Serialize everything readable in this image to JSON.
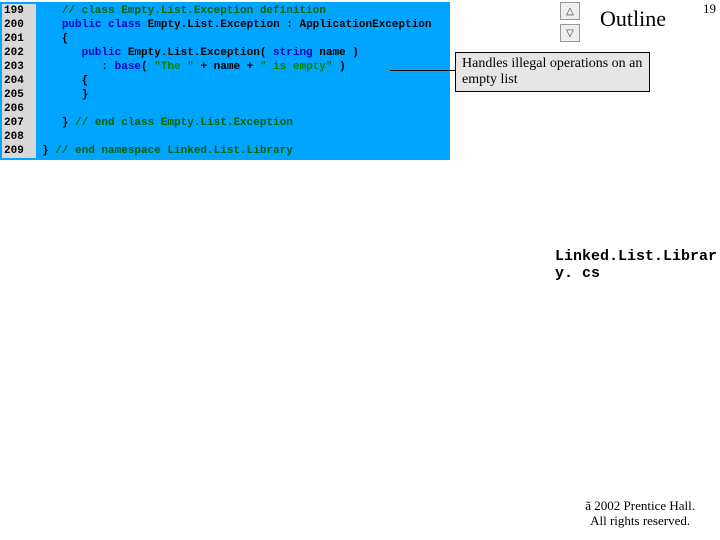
{
  "page_number": "19",
  "outline_label": "Outline",
  "callout_text": "Handles illegal operations on an empty list",
  "filename": "Linked.List.Librar\ny. cs",
  "copyright_l1": "ã 2002 Prentice Hall.",
  "copyright_l2": "All rights reserved.",
  "nav_up": "△",
  "nav_down": "▽",
  "code": [
    {
      "n": "199",
      "segs": [
        {
          "c": "kw-comment",
          "t": "   // class Empty.List.Exception definition"
        }
      ]
    },
    {
      "n": "200",
      "segs": [
        {
          "c": "kw-black",
          "t": "   "
        },
        {
          "c": "kw-blue",
          "t": "public"
        },
        {
          "c": "kw-black",
          "t": " "
        },
        {
          "c": "kw-blue",
          "t": "class"
        },
        {
          "c": "kw-black",
          "t": " Empty.List.Exception : Application"
        },
        {
          "c": "kw-black",
          "t": "Exception"
        }
      ]
    },
    {
      "n": "201",
      "segs": [
        {
          "c": "kw-black",
          "t": "   {"
        }
      ]
    },
    {
      "n": "202",
      "segs": [
        {
          "c": "kw-black",
          "t": "      "
        },
        {
          "c": "kw-blue",
          "t": "public"
        },
        {
          "c": "kw-black",
          "t": " Empty.List.Exception( "
        },
        {
          "c": "kw-blue",
          "t": "string"
        },
        {
          "c": "kw-black",
          "t": " name )"
        }
      ]
    },
    {
      "n": "203",
      "segs": [
        {
          "c": "kw-black",
          "t": "         : "
        },
        {
          "c": "kw-blue",
          "t": "base"
        },
        {
          "c": "kw-black",
          "t": "( "
        },
        {
          "c": "kw-str",
          "t": "\"The \""
        },
        {
          "c": "kw-black",
          "t": " + name + "
        },
        {
          "c": "kw-str",
          "t": "\" is empty\""
        },
        {
          "c": "kw-black",
          "t": " )"
        }
      ]
    },
    {
      "n": "204",
      "segs": [
        {
          "c": "kw-black",
          "t": "      {"
        }
      ]
    },
    {
      "n": "205",
      "segs": [
        {
          "c": "kw-black",
          "t": "      }"
        }
      ]
    },
    {
      "n": "206",
      "segs": [
        {
          "c": "kw-black",
          "t": ""
        }
      ]
    },
    {
      "n": "207",
      "segs": [
        {
          "c": "kw-black",
          "t": "   } "
        },
        {
          "c": "kw-comment",
          "t": "// end class Empty.List.Exception"
        }
      ]
    },
    {
      "n": "208",
      "segs": [
        {
          "c": "kw-black",
          "t": ""
        }
      ]
    },
    {
      "n": "209",
      "segs": [
        {
          "c": "kw-black",
          "t": "} "
        },
        {
          "c": "kw-comment",
          "t": "// end namespace Linked.List.Library"
        }
      ]
    }
  ]
}
